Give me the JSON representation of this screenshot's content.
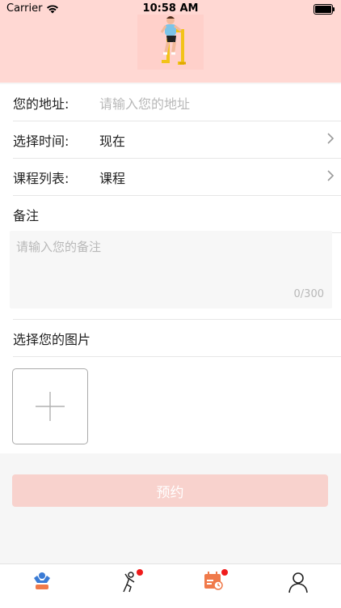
{
  "status_bar": {
    "carrier": "Carrier",
    "time": "10:58 AM"
  },
  "form": {
    "address": {
      "label": "您的地址:",
      "placeholder": "请输入您的地址"
    },
    "time": {
      "label": "选择时间:",
      "value": "现在"
    },
    "course": {
      "label": "课程列表:",
      "value": "课程"
    },
    "notes": {
      "label": "备注",
      "placeholder": "请输入您的备注",
      "counter": "0/300"
    },
    "photo": {
      "label": "选择您的图片"
    }
  },
  "submit_label": "预约",
  "tabbar": {
    "items": [
      {
        "icon": "fitness-home-icon",
        "badge": false,
        "active": true
      },
      {
        "icon": "workout-person-icon",
        "badge": true,
        "active": false
      },
      {
        "icon": "calendar-schedule-icon",
        "badge": true,
        "active": false
      },
      {
        "icon": "profile-user-icon",
        "badge": false,
        "active": false
      }
    ]
  },
  "colors": {
    "header_bg": "#ffd8d3",
    "submit_bg": "#f8d2cd",
    "badge": "#f01b1b",
    "accent_blue": "#3a7bd5",
    "accent_orange": "#f07a4a"
  }
}
